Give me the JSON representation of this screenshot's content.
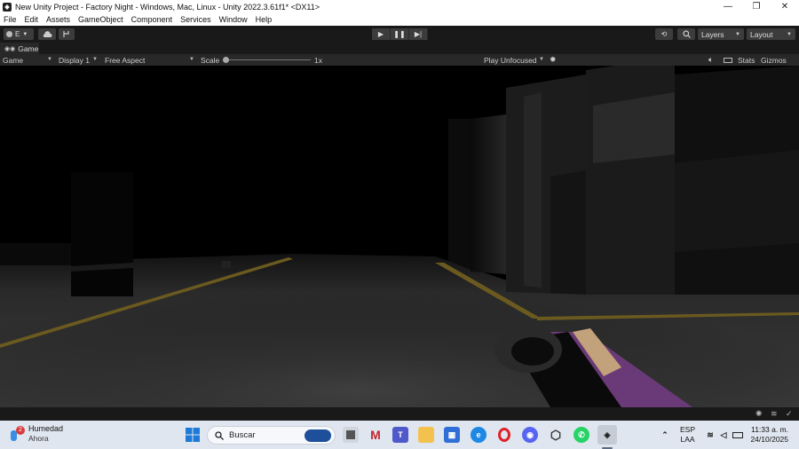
{
  "window": {
    "title": "New Unity Project - Factory Night - Windows, Mac, Linux - Unity 2022.3.61f1* <DX11>",
    "controls": [
      "—",
      "❐",
      "✕"
    ]
  },
  "menu": [
    "File",
    "Edit",
    "Assets",
    "GameObject",
    "Component",
    "Services",
    "Window",
    "Help"
  ],
  "toolbar": {
    "account_label": "E",
    "layers_label": "Layers",
    "layout_label": "Layout"
  },
  "tab": {
    "label": "Game"
  },
  "gamebar": {
    "mode": "Game",
    "display": "Display 1",
    "aspect": "Free Aspect",
    "scale_label": "Scale",
    "scale_value": "1x",
    "play_focus": "Play Unfocused",
    "stats": "Stats",
    "gizmos": "Gizmos"
  },
  "taskbar": {
    "weather_title": "Humedad",
    "weather_sub": "Ahora",
    "weather_badge": "2",
    "search_placeholder": "Buscar",
    "lang_top": "ESP",
    "lang_bottom": "LAA",
    "time": "11:33 a. m.",
    "date": "24/10/2025"
  },
  "colors": {
    "unity_dark": "#191919",
    "unity_panel": "#282828",
    "taskbar_bg": "#dfe6ef"
  }
}
